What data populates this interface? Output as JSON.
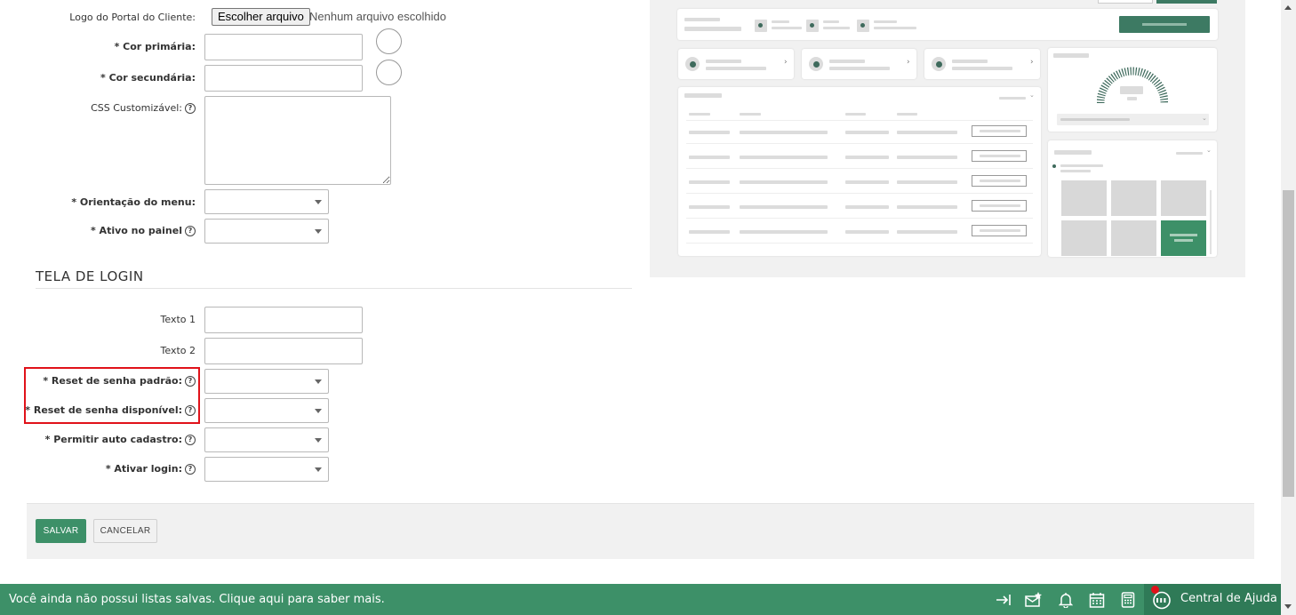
{
  "form": {
    "logo_label": "Logo do Portal do Cliente:",
    "file_button": "Escolher arquivo",
    "file_status": "Nenhum arquivo escolhido",
    "primary_color_label": "* Cor primária:",
    "secondary_color_label": "* Cor secundária:",
    "custom_css_label": "CSS Customizável:",
    "menu_orientation_label": "* Orientação do menu:",
    "active_panel_label": "* Ativo no painel"
  },
  "login_section": {
    "title": "TELA DE LOGIN",
    "text1_label": "Texto 1",
    "text2_label": "Texto 2",
    "reset_default_label": "* Reset de senha padrão:",
    "reset_available_label": "* Reset de senha disponível:",
    "auto_register_label": "* Permitir auto cadastro:",
    "enable_login_label": "* Ativar login:"
  },
  "actions": {
    "save": "SALVAR",
    "cancel": "CANCELAR"
  },
  "help_glyph": "?",
  "statusbar": {
    "message": "Você ainda não possui listas salvas. Clique aqui para saber mais.",
    "help_center": "Central de Ajuda",
    "icons": [
      "collapse-icon",
      "mail-star-icon",
      "bell-icon",
      "calendar-icon",
      "calculator-icon",
      "chat-icon"
    ]
  },
  "colors": {
    "accent": "#3d9068",
    "accent_dark": "#2f7a57",
    "preview_dark": "#3e6a5c",
    "highlight": "#e0121a",
    "notification": "#e0121a"
  }
}
